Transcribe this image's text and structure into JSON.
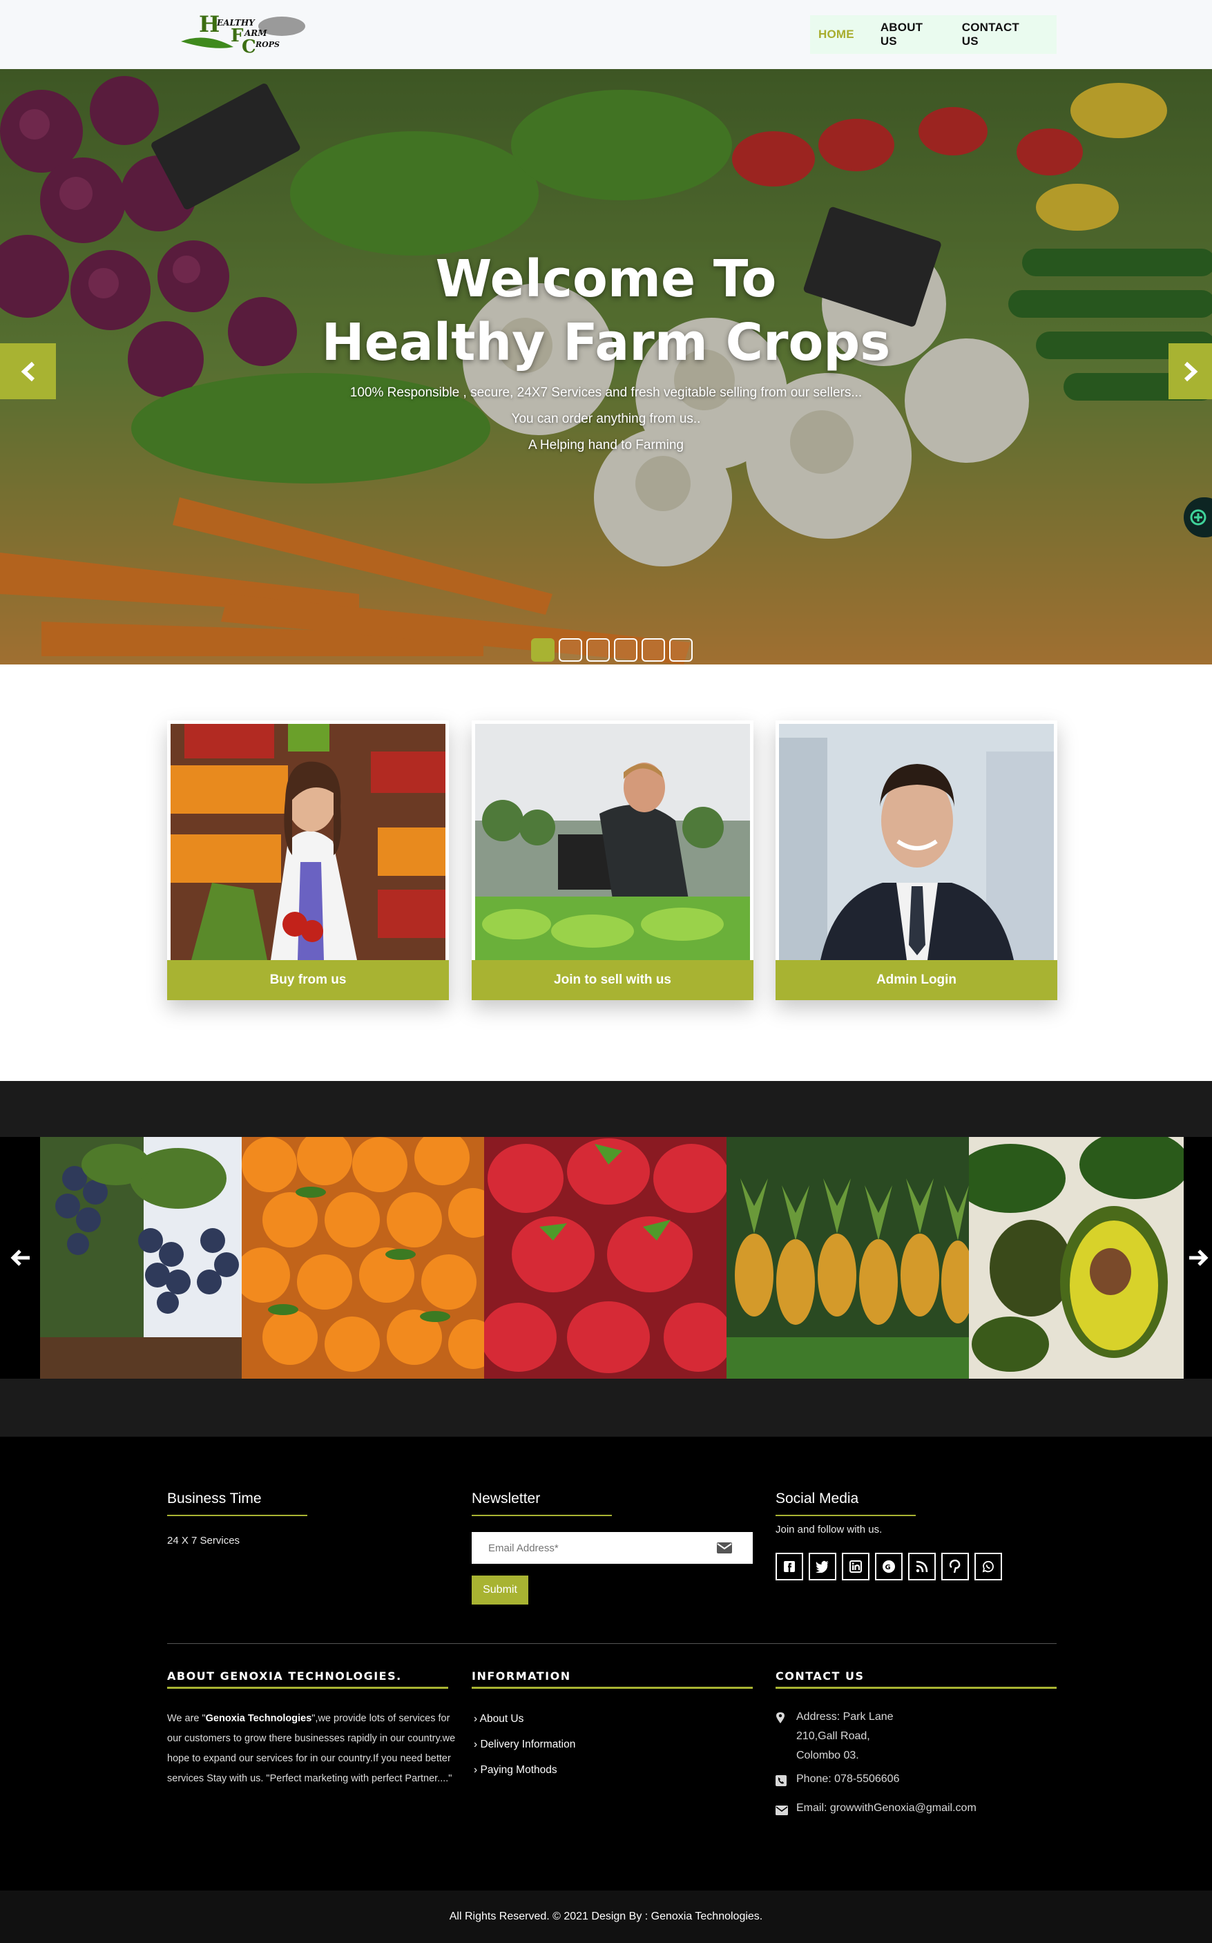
{
  "header": {
    "logo_letters": [
      "H",
      "F",
      "C"
    ],
    "logo_words": [
      "EALTHY",
      "ARM",
      "ROPS"
    ],
    "nav": [
      {
        "label": "HOME",
        "active": true
      },
      {
        "label": "ABOUT US",
        "active": false
      },
      {
        "label": "CONTACT US",
        "active": false
      }
    ]
  },
  "hero": {
    "title_line1": "Welcome To",
    "title_line2": "Healthy Farm Crops",
    "subtitle_lines": [
      "100% Responsible , secure, 24X7 Services and fresh vegitable selling from our sellers...",
      "You can order anything from us..",
      "A Helping hand to Farming"
    ],
    "slide_count": 6,
    "active_slide": 1
  },
  "cards": [
    {
      "label": "Buy from us"
    },
    {
      "label": "Join to sell with us"
    },
    {
      "label": "Admin Login"
    }
  ],
  "fruits": [
    "grapes",
    "oranges",
    "strawberries",
    "pineapples",
    "avocados"
  ],
  "footer": {
    "business_time": {
      "heading": "Business Time",
      "text": "24 X 7 Services"
    },
    "newsletter": {
      "heading": "Newsletter",
      "placeholder": "Email Address*",
      "submit_label": "Submit"
    },
    "social": {
      "heading": "Social Media",
      "text": "Join and follow with us.",
      "icons": [
        "facebook-icon",
        "twitter-icon",
        "linkedin-icon",
        "google-plus-icon",
        "rss-icon",
        "pinterest-icon",
        "whatsapp-icon"
      ]
    },
    "about": {
      "heading": "ABOUT GENOXIA TECHNOLOGIES.",
      "text_pre": "We are \"",
      "text_bold": "Genoxia Technologies",
      "text_post": "\",we provide lots of services for our customers to grow there businesses rapidly in our country.we hope to expand our services for in our country.If you need better services Stay with us. \"Perfect marketing with perfect Partner....\""
    },
    "information": {
      "heading": "INFORMATION",
      "links": [
        "About Us",
        "Delivery Information",
        "Paying Mothods"
      ]
    },
    "contact": {
      "heading": "CONTACT US",
      "address_lines": [
        "Address: Park Lane",
        "210,Gall Road,",
        "Colombo 03."
      ],
      "phone": "Phone: 078-5506606",
      "email": "Email: growwithGenoxia@gmail.com"
    },
    "copyright": "All Rights Reserved. © 2021 Design By : Genoxia Technologies."
  },
  "colors": {
    "accent": "#a8b332",
    "footer_bg": "#000000",
    "strip_bg": "#1b1b1b"
  }
}
